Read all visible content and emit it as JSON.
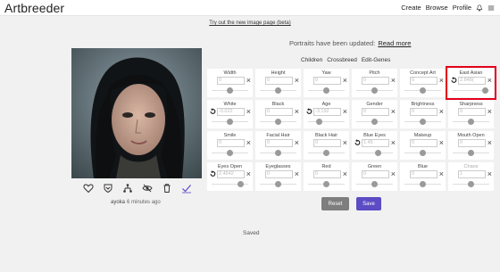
{
  "topbar": {
    "brand": "Artbreeder",
    "nav": [
      {
        "label": "Create"
      },
      {
        "label": "Browse"
      },
      {
        "label": "Profile"
      }
    ]
  },
  "banner": {
    "try_link": "Try out the new image page (beta)",
    "notice": "Portraits have been updated:",
    "notice_link": "Read more"
  },
  "tabs": [
    "Children",
    "Crossbreed",
    "Edit-Genes"
  ],
  "genes": [
    {
      "label": "Width",
      "value": "0",
      "level": 0.5,
      "has_reset": false
    },
    {
      "label": "Height",
      "value": "0",
      "level": 0.5,
      "has_reset": false
    },
    {
      "label": "Yaw",
      "value": "0",
      "level": 0.5,
      "has_reset": false
    },
    {
      "label": "Pitch",
      "value": "0",
      "level": 0.5,
      "has_reset": false
    },
    {
      "label": "Concept Art",
      "value": "0",
      "level": 0.5,
      "has_reset": false
    },
    {
      "label": "East Asian",
      "value": "2.848(",
      "level": 0.9,
      "has_reset": true,
      "highlighted": true
    },
    {
      "label": "White",
      "value": "-0.022",
      "level": 0.5,
      "has_reset": true
    },
    {
      "label": "Black",
      "value": "0",
      "level": 0.5,
      "has_reset": false
    },
    {
      "label": "Age",
      "value": "-3.192",
      "level": 0.3,
      "has_reset": true
    },
    {
      "label": "Gender",
      "value": "0",
      "level": 0.5,
      "has_reset": false
    },
    {
      "label": "Brightness",
      "value": "0",
      "level": 0.5,
      "has_reset": false
    },
    {
      "label": "Sharpness",
      "value": "0",
      "level": 0.5,
      "has_reset": false
    },
    {
      "label": "Smile",
      "value": "0",
      "level": 0.5,
      "has_reset": false
    },
    {
      "label": "Facial Hair",
      "value": "0",
      "level": 0.5,
      "has_reset": false
    },
    {
      "label": "Black Hair",
      "value": "0",
      "level": 0.5,
      "has_reset": false
    },
    {
      "label": "Blue Eyes",
      "value": "1.45",
      "level": 0.6,
      "has_reset": true
    },
    {
      "label": "Makeup",
      "value": "0",
      "level": 0.5,
      "has_reset": false
    },
    {
      "label": "Mouth Open",
      "value": "0",
      "level": 0.5,
      "has_reset": false
    },
    {
      "label": "Eyes Open",
      "value": "2.4642",
      "level": 0.8,
      "has_reset": true
    },
    {
      "label": "Eyeglasses",
      "value": "0",
      "level": 0.5,
      "has_reset": false
    },
    {
      "label": "Red",
      "value": "0",
      "level": 0.5,
      "has_reset": false
    },
    {
      "label": "Green",
      "value": "0",
      "level": 0.5,
      "has_reset": false
    },
    {
      "label": "Blue",
      "value": "0",
      "level": 0.5,
      "has_reset": false
    },
    {
      "label": "Chaos",
      "value": "1",
      "level": 0.5,
      "has_reset": false,
      "dim": true
    }
  ],
  "caption": {
    "user": "ayoka",
    "time": "6 minutes ago"
  },
  "buttons": {
    "reset": "Reset",
    "save": "Save"
  },
  "status": "Saved",
  "colors": {
    "accent": "#5b4bc4",
    "highlight": "#e3001b",
    "reset_button": "#7e7e7e"
  },
  "icons": [
    "heart-icon",
    "shield-icon",
    "family-tree-icon",
    "hide-icon",
    "trash-icon",
    "check-icon",
    "undo-icon",
    "close-icon",
    "bell-icon",
    "menu-icon"
  ]
}
